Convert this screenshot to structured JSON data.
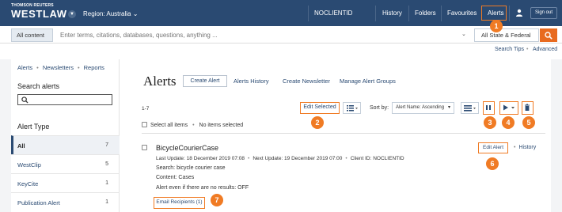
{
  "header": {
    "logo_top": "THOMSON REUTERS",
    "logo_main": "WESTLAW",
    "region": "Region: Australia",
    "nav": {
      "client": "NOCLIENTID",
      "history": "History",
      "folders": "Folders",
      "favourites": "Favourites",
      "alerts": "Alerts",
      "signout": "Sign out"
    }
  },
  "search": {
    "content_select": "All content",
    "placeholder": "Enter terms, citations, databases, questions, anything ...",
    "jurisdiction": "All State & Federal",
    "tips": "Search Tips",
    "advanced": "Advanced"
  },
  "sidebar": {
    "links": [
      "Alerts",
      "Newsletters",
      "Reports"
    ],
    "search_heading": "Search alerts",
    "type_heading": "Alert Type",
    "items": [
      {
        "label": "All",
        "count": "7"
      },
      {
        "label": "WestClip",
        "count": "5"
      },
      {
        "label": "KeyCite",
        "count": "1"
      },
      {
        "label": "Publication Alert",
        "count": "1"
      }
    ]
  },
  "main": {
    "title": "Alerts",
    "create_alert": "Create Alert",
    "alerts_history": "Alerts History",
    "create_newsletter": "Create Newsletter",
    "manage_groups": "Manage Alert Groups",
    "count": "1-7",
    "edit_selected": "Edit Selected",
    "sort_by": "Sort by:",
    "sort_value": "Alert Name: Ascending",
    "select_all": "Select all items",
    "no_items": "No items selected"
  },
  "alert": {
    "title": "BicycleCourierCase",
    "last_update": "Last Update: 18 December 2019 07:08",
    "next_update": "Next Update: 19 December 2019 07:00",
    "client_id": "Client ID: NOCLIENTID",
    "search": "Search: bicycle courier case",
    "content": "Content: Cases",
    "no_results": "Alert even if there are no results: OFF",
    "edit_alert": "Edit Alert",
    "history": "History",
    "email_recipients": "Email Recipients (1)"
  },
  "callouts": [
    "1",
    "2",
    "3",
    "4",
    "5",
    "6",
    "7"
  ],
  "colors": {
    "nav_bg": "#2a4a72",
    "accent": "#f07b24",
    "search_button": "#e86a1f"
  }
}
